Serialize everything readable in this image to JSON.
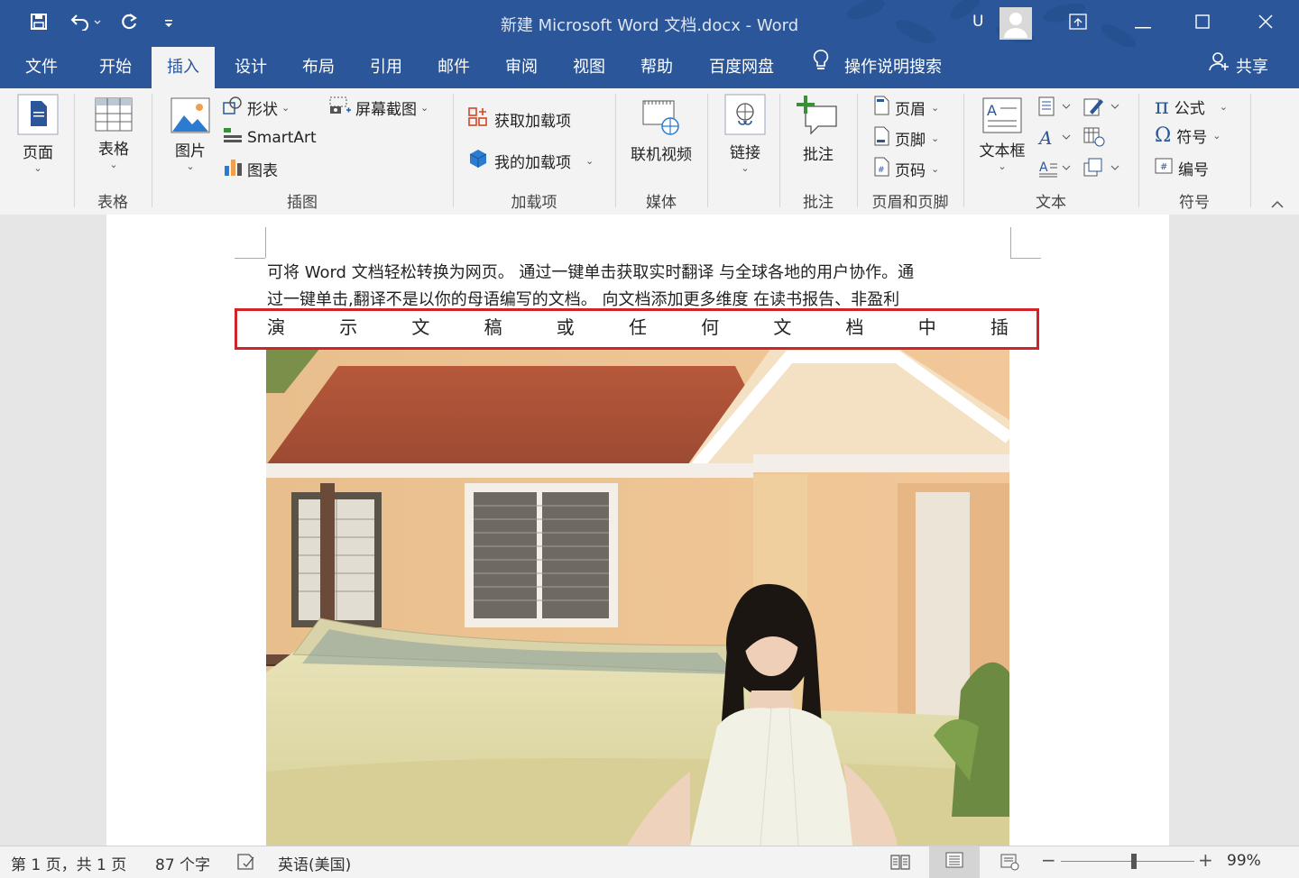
{
  "window": {
    "title": "新建 Microsoft Word 文档.docx  -  Word",
    "user_initial": "U"
  },
  "tabs": [
    {
      "label": "文件"
    },
    {
      "label": "开始"
    },
    {
      "label": "插入"
    },
    {
      "label": "设计"
    },
    {
      "label": "布局"
    },
    {
      "label": "引用"
    },
    {
      "label": "邮件"
    },
    {
      "label": "审阅"
    },
    {
      "label": "视图"
    },
    {
      "label": "帮助"
    },
    {
      "label": "百度网盘"
    }
  ],
  "active_tab": "插入",
  "tell_me": "操作说明搜索",
  "share": "共享",
  "ribbon": {
    "page_btn": "页面",
    "table_btn": "表格",
    "picture_btn": "图片",
    "shapes": "形状",
    "screenshot": "屏幕截图",
    "smartart": "SmartArt",
    "chart": "图表",
    "get_addins": "获取加载项",
    "my_addins": "我的加载项",
    "online_video": "联机视频",
    "link": "链接",
    "comment": "批注",
    "header": "页眉",
    "footer": "页脚",
    "page_number": "页码",
    "textbox": "文本框",
    "equation": "公式",
    "symbol": "符号",
    "numbering": "编号",
    "groups": {
      "tables": "表格",
      "illustrations": "插图",
      "addins": "加载项",
      "media": "媒体",
      "comments": "批注",
      "header_footer": "页眉和页脚",
      "text": "文本",
      "symbols": "符号"
    }
  },
  "document": {
    "line1": "可将 Word 文档轻松转换为网页。 通过一键单击获取实时翻译  与全球各地的用户协作。通",
    "line2": "过一键单击,翻译不是以你的母语编写的文档。  向文档添加更多维度  在读书报告、非盈利",
    "spread_chars": [
      "演",
      "示",
      "文",
      "稿",
      "或",
      "任",
      "何",
      "文",
      "档",
      "中",
      "插"
    ]
  },
  "status": {
    "page": "第 1 页，共 1 页",
    "words": "87 个字",
    "language": "英语(美国)",
    "zoom": "99%",
    "zoom_fraction": 0.55
  },
  "colors": {
    "brand": "#2b579a",
    "highlight_box": "#d0232a"
  }
}
